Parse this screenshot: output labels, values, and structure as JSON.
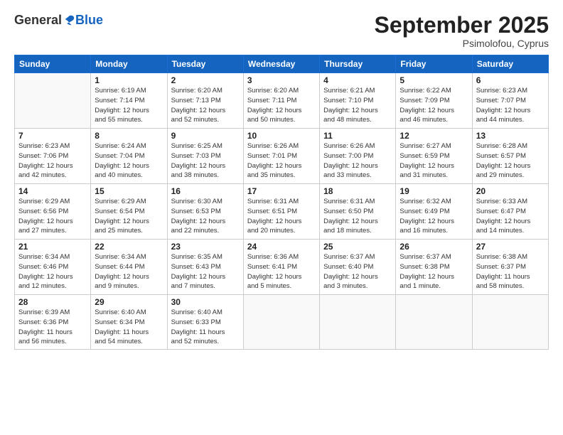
{
  "logo": {
    "general": "General",
    "blue": "Blue"
  },
  "header": {
    "month": "September 2025",
    "location": "Psimolofou, Cyprus"
  },
  "weekdays": [
    "Sunday",
    "Monday",
    "Tuesday",
    "Wednesday",
    "Thursday",
    "Friday",
    "Saturday"
  ],
  "weeks": [
    [
      {
        "num": "",
        "info": ""
      },
      {
        "num": "1",
        "info": "Sunrise: 6:19 AM\nSunset: 7:14 PM\nDaylight: 12 hours\nand 55 minutes."
      },
      {
        "num": "2",
        "info": "Sunrise: 6:20 AM\nSunset: 7:13 PM\nDaylight: 12 hours\nand 52 minutes."
      },
      {
        "num": "3",
        "info": "Sunrise: 6:20 AM\nSunset: 7:11 PM\nDaylight: 12 hours\nand 50 minutes."
      },
      {
        "num": "4",
        "info": "Sunrise: 6:21 AM\nSunset: 7:10 PM\nDaylight: 12 hours\nand 48 minutes."
      },
      {
        "num": "5",
        "info": "Sunrise: 6:22 AM\nSunset: 7:09 PM\nDaylight: 12 hours\nand 46 minutes."
      },
      {
        "num": "6",
        "info": "Sunrise: 6:23 AM\nSunset: 7:07 PM\nDaylight: 12 hours\nand 44 minutes."
      }
    ],
    [
      {
        "num": "7",
        "info": "Sunrise: 6:23 AM\nSunset: 7:06 PM\nDaylight: 12 hours\nand 42 minutes."
      },
      {
        "num": "8",
        "info": "Sunrise: 6:24 AM\nSunset: 7:04 PM\nDaylight: 12 hours\nand 40 minutes."
      },
      {
        "num": "9",
        "info": "Sunrise: 6:25 AM\nSunset: 7:03 PM\nDaylight: 12 hours\nand 38 minutes."
      },
      {
        "num": "10",
        "info": "Sunrise: 6:26 AM\nSunset: 7:01 PM\nDaylight: 12 hours\nand 35 minutes."
      },
      {
        "num": "11",
        "info": "Sunrise: 6:26 AM\nSunset: 7:00 PM\nDaylight: 12 hours\nand 33 minutes."
      },
      {
        "num": "12",
        "info": "Sunrise: 6:27 AM\nSunset: 6:59 PM\nDaylight: 12 hours\nand 31 minutes."
      },
      {
        "num": "13",
        "info": "Sunrise: 6:28 AM\nSunset: 6:57 PM\nDaylight: 12 hours\nand 29 minutes."
      }
    ],
    [
      {
        "num": "14",
        "info": "Sunrise: 6:29 AM\nSunset: 6:56 PM\nDaylight: 12 hours\nand 27 minutes."
      },
      {
        "num": "15",
        "info": "Sunrise: 6:29 AM\nSunset: 6:54 PM\nDaylight: 12 hours\nand 25 minutes."
      },
      {
        "num": "16",
        "info": "Sunrise: 6:30 AM\nSunset: 6:53 PM\nDaylight: 12 hours\nand 22 minutes."
      },
      {
        "num": "17",
        "info": "Sunrise: 6:31 AM\nSunset: 6:51 PM\nDaylight: 12 hours\nand 20 minutes."
      },
      {
        "num": "18",
        "info": "Sunrise: 6:31 AM\nSunset: 6:50 PM\nDaylight: 12 hours\nand 18 minutes."
      },
      {
        "num": "19",
        "info": "Sunrise: 6:32 AM\nSunset: 6:49 PM\nDaylight: 12 hours\nand 16 minutes."
      },
      {
        "num": "20",
        "info": "Sunrise: 6:33 AM\nSunset: 6:47 PM\nDaylight: 12 hours\nand 14 minutes."
      }
    ],
    [
      {
        "num": "21",
        "info": "Sunrise: 6:34 AM\nSunset: 6:46 PM\nDaylight: 12 hours\nand 12 minutes."
      },
      {
        "num": "22",
        "info": "Sunrise: 6:34 AM\nSunset: 6:44 PM\nDaylight: 12 hours\nand 9 minutes."
      },
      {
        "num": "23",
        "info": "Sunrise: 6:35 AM\nSunset: 6:43 PM\nDaylight: 12 hours\nand 7 minutes."
      },
      {
        "num": "24",
        "info": "Sunrise: 6:36 AM\nSunset: 6:41 PM\nDaylight: 12 hours\nand 5 minutes."
      },
      {
        "num": "25",
        "info": "Sunrise: 6:37 AM\nSunset: 6:40 PM\nDaylight: 12 hours\nand 3 minutes."
      },
      {
        "num": "26",
        "info": "Sunrise: 6:37 AM\nSunset: 6:38 PM\nDaylight: 12 hours\nand 1 minute."
      },
      {
        "num": "27",
        "info": "Sunrise: 6:38 AM\nSunset: 6:37 PM\nDaylight: 11 hours\nand 58 minutes."
      }
    ],
    [
      {
        "num": "28",
        "info": "Sunrise: 6:39 AM\nSunset: 6:36 PM\nDaylight: 11 hours\nand 56 minutes."
      },
      {
        "num": "29",
        "info": "Sunrise: 6:40 AM\nSunset: 6:34 PM\nDaylight: 11 hours\nand 54 minutes."
      },
      {
        "num": "30",
        "info": "Sunrise: 6:40 AM\nSunset: 6:33 PM\nDaylight: 11 hours\nand 52 minutes."
      },
      {
        "num": "",
        "info": ""
      },
      {
        "num": "",
        "info": ""
      },
      {
        "num": "",
        "info": ""
      },
      {
        "num": "",
        "info": ""
      }
    ]
  ]
}
